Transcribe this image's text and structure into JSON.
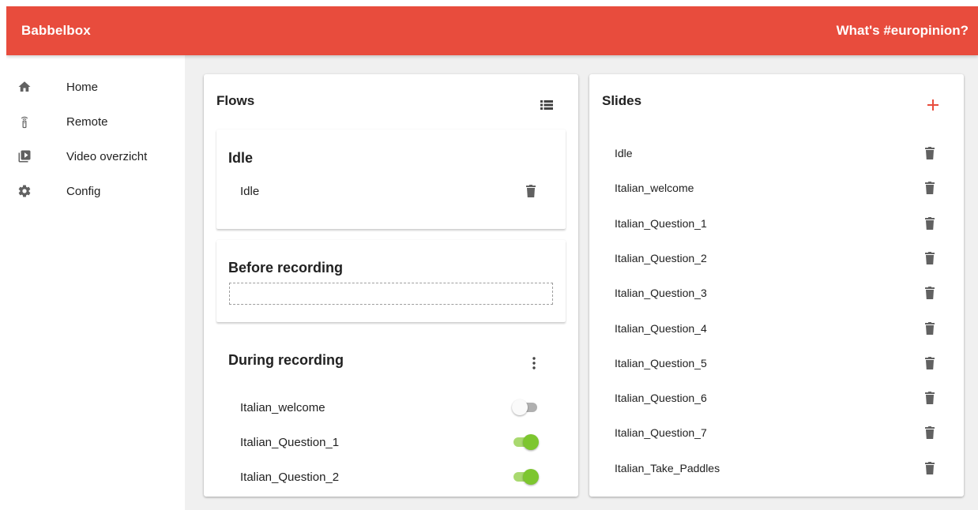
{
  "header": {
    "brand": "Babbelbox",
    "tagline": "What's #europinion?"
  },
  "sidebar": {
    "items": [
      {
        "label": "Home",
        "icon": "home-icon"
      },
      {
        "label": "Remote",
        "icon": "remote-icon"
      },
      {
        "label": "Video overzicht",
        "icon": "video-library-icon"
      },
      {
        "label": "Config",
        "icon": "gear-icon"
      }
    ]
  },
  "flows": {
    "title": "Flows",
    "header_icon": "list-icon",
    "sections": [
      {
        "title": "Idle",
        "items": [
          {
            "label": "Idle"
          }
        ]
      },
      {
        "title": "Before recording",
        "items": []
      },
      {
        "title": "During recording",
        "menu_icon": "more-vert-icon",
        "items": [
          {
            "label": "Italian_welcome",
            "enabled": false
          },
          {
            "label": "Italian_Question_1",
            "enabled": true
          },
          {
            "label": "Italian_Question_2",
            "enabled": true
          }
        ]
      }
    ]
  },
  "slides": {
    "title": "Slides",
    "add_icon": "plus-icon",
    "items": [
      "Idle",
      "Italian_welcome",
      "Italian_Question_1",
      "Italian_Question_2",
      "Italian_Question_3",
      "Italian_Question_4",
      "Italian_Question_5",
      "Italian_Question_6",
      "Italian_Question_7",
      "Italian_Take_Paddles"
    ]
  },
  "colors": {
    "primary": "#e84c3d",
    "toggle_on": "#7dc62f",
    "icon": "#616161"
  }
}
